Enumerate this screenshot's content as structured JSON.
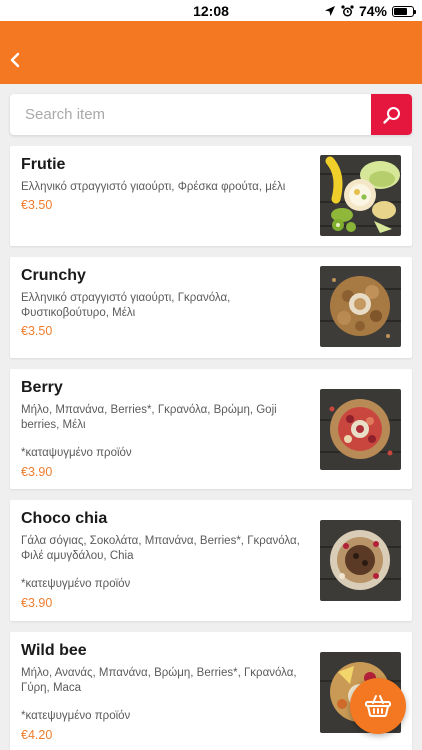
{
  "status": {
    "time": "12:08",
    "battery": "74%",
    "battery_level": 0.74
  },
  "header": {
    "back_icon": "chevron-left-icon"
  },
  "search": {
    "placeholder": "Search item",
    "value": "",
    "icon": "search-icon"
  },
  "items": [
    {
      "title": "Frutie",
      "description": "Ελληνικό στραγγιστό γιαούρτι, Φρέσκα φρούτα, μέλι",
      "note": "",
      "price": "€3.50"
    },
    {
      "title": "Crunchy",
      "description": "Ελληνικό στραγγιστό γιαούρτι, Γκρανόλα, Φυστικοβούτυρο, Μέλι",
      "note": "",
      "price": "€3.50"
    },
    {
      "title": "Berry",
      "description": "Μήλο, Μπανάνα, Berries*, Γκρανόλα, Βρώμη, Goji berries, Μέλι",
      "note": "*καταψυγμένο προϊόν",
      "price": "€3.90"
    },
    {
      "title": "Choco chia",
      "description": "Γάλα σόγιας, Σοκολάτα, Μπανάνα, Berries*, Γκρανόλα, Φιλέ αμυγδάλου, Chia",
      "note": "*κατεψυγμένο προϊόν",
      "price": "€3.90"
    },
    {
      "title": "Wild bee",
      "description": "Μήλο, Ανανάς, Μπανάνα, Βρώμη, Berries*, Γκρανόλα, Γύρη, Maca",
      "note": "*κατεψυγμένο προϊόν",
      "price": "€4.20"
    }
  ],
  "cart": {
    "icon": "basket-icon"
  },
  "colors": {
    "primary": "#f47721",
    "accent": "#e5173f",
    "price": "#ef7d2d"
  }
}
